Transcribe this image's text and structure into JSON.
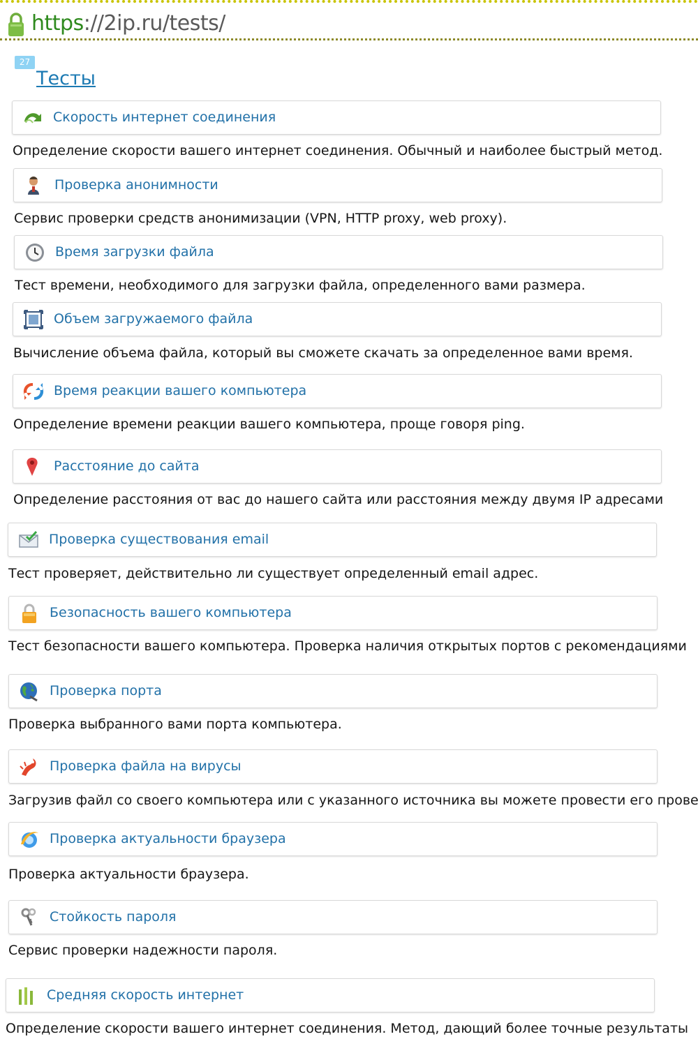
{
  "address_bar": {
    "url_scheme": "https",
    "url_rest": "://2ip.ru/tests/"
  },
  "page": {
    "badge": "27",
    "title": "Тесты"
  },
  "tests": [
    {
      "icon": "speed-arrow-icon",
      "label": "Скорость интернет соединения",
      "description": "Определение скорости вашего интернет соединения. Обычный и наиболее быстрый метод."
    },
    {
      "icon": "anonymous-user-icon",
      "label": "Проверка анонимности",
      "description": "Сервис проверки средств анонимизации (VPN, HTTP proxy, web proxy)."
    },
    {
      "icon": "clock-icon",
      "label": "Время загрузки файла",
      "description": "Тест времени, необходимого для загрузки файла, определенного вами размера."
    },
    {
      "icon": "file-size-icon",
      "label": "Объем загружаемого файла",
      "description": "Вычисление объема файла, который вы сможете скачать за определенное вами время."
    },
    {
      "icon": "refresh-icon",
      "label": "Время реакции вашего компьютера",
      "description": "Определение времени реакции вашего компьютера, проще говоря ping."
    },
    {
      "icon": "map-pin-icon",
      "label": "Расстояние до сайта",
      "description": "Определение расстояния от вас до нашего сайта или расстояния между двумя IP адресами"
    },
    {
      "icon": "envelope-check-icon",
      "label": "Проверка существования email",
      "description": "Тест проверяет, действительно ли существует определенный email адрес."
    },
    {
      "icon": "padlock-icon",
      "label": "Безопасность вашего компьютера",
      "description": "Тест безопасности вашего компьютера. Проверка наличия открытых портов с рекомендациями"
    },
    {
      "icon": "globe-icon",
      "label": "Проверка порта",
      "description": "Проверка выбранного вами порта компьютера."
    },
    {
      "icon": "virus-icon",
      "label": "Проверка файла на вирусы",
      "description": "Загрузив файл со своего компьютера или с указанного источника вы можете провести его проверку"
    },
    {
      "icon": "browser-icon",
      "label": "Проверка актуальности браузера",
      "description": "Проверка актуальности браузера."
    },
    {
      "icon": "keys-icon",
      "label": "Стойкость пароля",
      "description": "Сервис проверки надежности пароля."
    },
    {
      "icon": "bars-icon",
      "label": "Средняя скорость интернет",
      "description": "Определение скорости вашего интернет соединения. Метод, дающий более точные результаты"
    }
  ]
}
